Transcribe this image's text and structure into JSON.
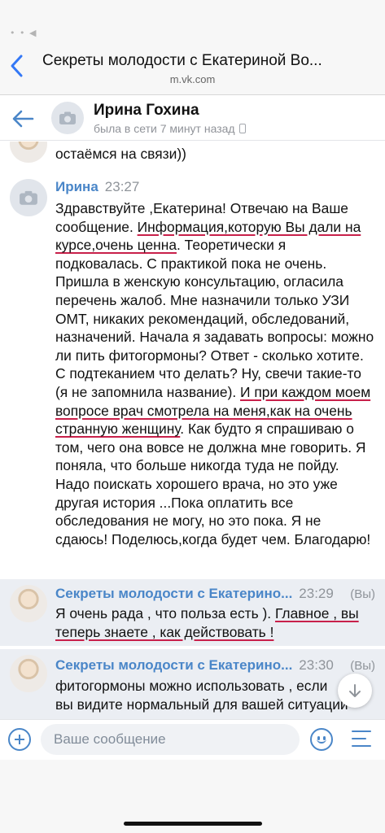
{
  "browser": {
    "status_text": "• • ◀",
    "title": "Секреты молодости с Екатериной Во...",
    "url": "m.vk.com"
  },
  "conversation": {
    "name": "Ирина Гохина",
    "status": "была в сети 7 минут назад"
  },
  "messages": {
    "partial_text": "остаёмся на связи))",
    "m1": {
      "sender": "Ирина",
      "time": "23:27",
      "t1": "Здравствуйте ,Екатерина! Отвечаю на Ваше сообщение. ",
      "u1": "Информация,которую Вы дали на курсе,очень ценна",
      "t2": ". Теоретически я подковалась. С практикой пока не очень. Пришла в женскую консультацию, огласила перечень жалоб. Мне назначили только УЗИ ОМТ, никаких рекомендаций, обследований, назначений. Начала я задавать вопросы: можно ли пить фитогормоны? Ответ - сколько хотите. С подтеканием что делать? Ну, свечи такие-то (я не запомнила название). ",
      "u2": "И при каждом моем вопросе врач смотрела на меня,как на очень странную женщину",
      "t3": ". Как будто я спрашиваю о том, чего она вовсе не должна мне говорить. Я поняла, что больше никогда туда не пойду. Надо поискать хорошего врача, но это уже другая история ...Пока оплатить все обследования не могу, но это пока. Я не сдаюсь! Поделюсь,когда будет чем. Благодарю!"
    },
    "m2": {
      "sender": "Секреты молодости с Екатерино...",
      "time": "23:29",
      "you_label": "(Вы)",
      "t1": "Я очень рада , что польза есть ). ",
      "u1": "Главное , вы теперь знаете , как действовать !"
    },
    "m3": {
      "sender": "Секреты молодости с Екатерино...",
      "time": "23:30",
      "you_label": "(Вы)",
      "t1": "фитогормоны можно использовать , если вы видите нормальный для вашей ситуации"
    }
  },
  "composer": {
    "placeholder": "Ваше сообщение"
  },
  "colors": {
    "accent": "#4a86c8",
    "underline": "#c8204a",
    "outgoing_bg": "#ebeef3"
  },
  "icons": [
    "back-chevron-icon",
    "back-arrow-icon",
    "camera-icon",
    "phone-icon",
    "plus-icon",
    "emoji-icon",
    "menu-icon",
    "chevron-down-icon"
  ]
}
